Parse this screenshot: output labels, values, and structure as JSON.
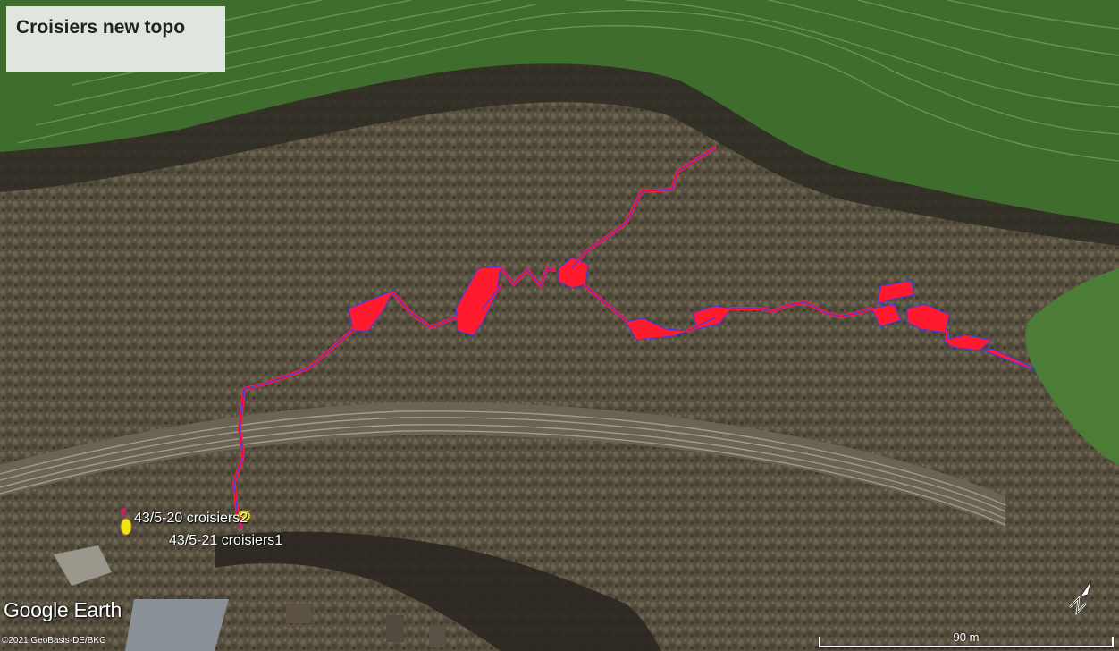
{
  "title": "Croisiers new topo",
  "placemarks": [
    {
      "label": "43/5-20 croisiers2"
    },
    {
      "label": "43/5-21 croisiers1"
    }
  ],
  "branding": {
    "logo": "Google Earth",
    "copyright": "©2021 GeoBasis-DE/BKG"
  },
  "scale": {
    "label": "90 m"
  },
  "colors": {
    "survey_fill": "#ff1a2e",
    "survey_line": "#3b3cf0",
    "pin": "#f3e51c",
    "pin_head": "#d01b6a"
  },
  "icons": [
    "pushpin-icon",
    "compass-north-icon"
  ]
}
